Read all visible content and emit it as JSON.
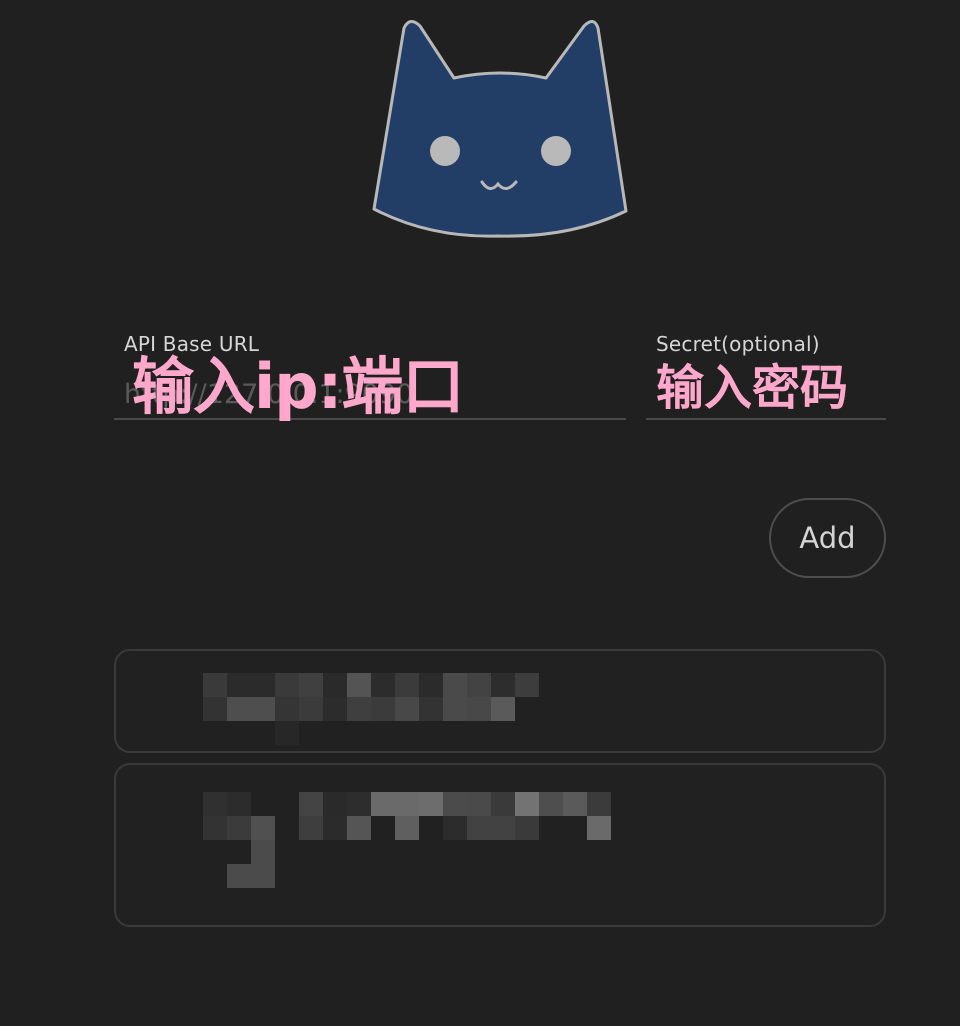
{
  "form": {
    "url_label": "API Base URL",
    "url_placeholder": "http://127.0.0.1:9090",
    "secret_label": "Secret(optional)",
    "secret_placeholder": "",
    "add_label": "Add"
  },
  "annotations": {
    "url_hint": "输入ip:端口",
    "secret_hint": "输入密码"
  },
  "backends": [
    {
      "status": "redacted"
    },
    {
      "status": "redacted"
    }
  ],
  "colors": {
    "background": "#202020",
    "logo_fill": "#223d66",
    "logo_stroke": "#b8b8b8",
    "annotation": "#ffa8cc",
    "border": "#3a3a3a"
  }
}
